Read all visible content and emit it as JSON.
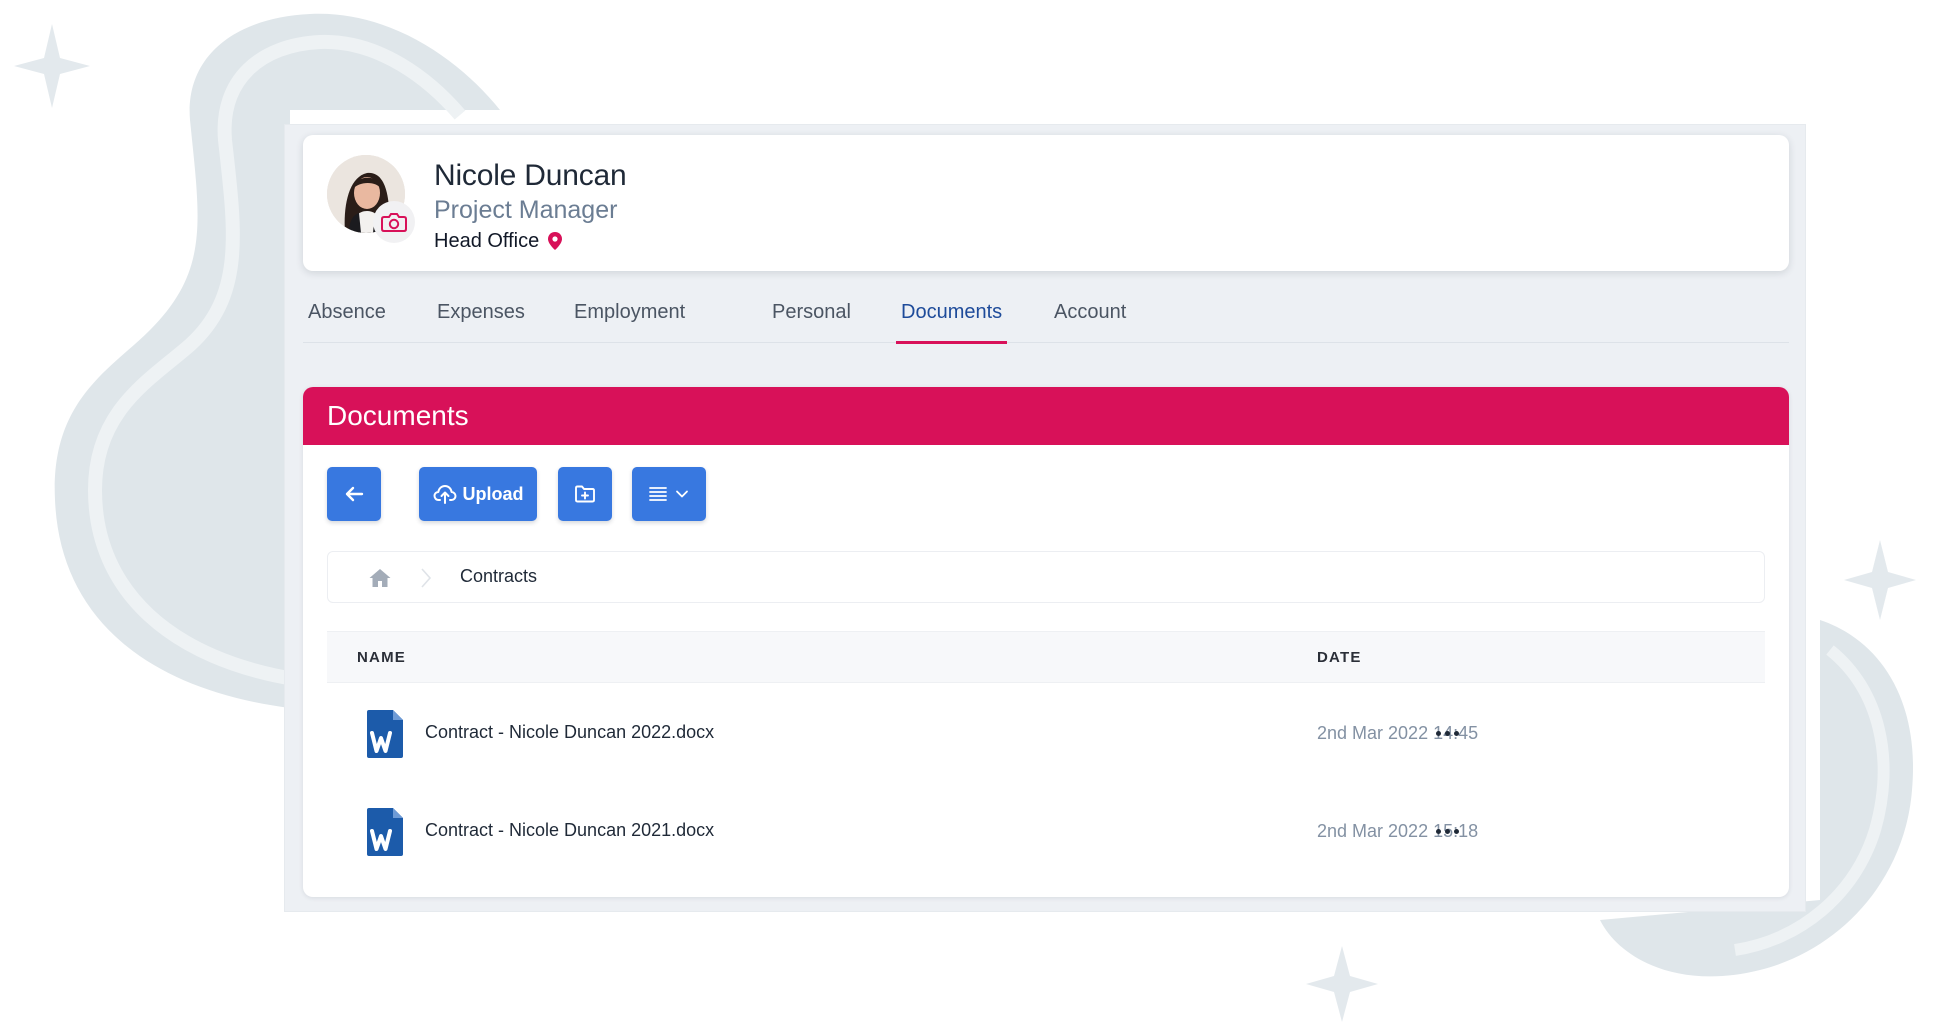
{
  "profile": {
    "name": "Nicole Duncan",
    "role": "Project Manager",
    "location": "Head Office"
  },
  "tabs": [
    {
      "label": "Absence",
      "active": false
    },
    {
      "label": "Expenses",
      "active": false
    },
    {
      "label": "Employment",
      "active": false
    },
    {
      "label": "Personal",
      "active": false
    },
    {
      "label": "Documents",
      "active": true
    },
    {
      "label": "Account",
      "active": false
    }
  ],
  "documents": {
    "title": "Documents",
    "toolbar": {
      "back_icon": "arrow-left-icon",
      "upload_label": "Upload",
      "upload_icon": "cloud-upload-icon",
      "new_folder_icon": "folder-plus-icon",
      "view_icon": "list-view-icon"
    },
    "breadcrumb": {
      "home_icon": "home-icon",
      "current": "Contracts"
    },
    "columns": {
      "name": "NAME",
      "date": "DATE"
    },
    "files": [
      {
        "name": "Contract - Nicole Duncan 2022.docx",
        "date": "2nd Mar 2022 14:45",
        "icon": "word-document-icon"
      },
      {
        "name": "Contract - Nicole Duncan 2021.docx",
        "date": "2nd Mar 2022 15:18",
        "icon": "word-document-icon"
      }
    ]
  },
  "colors": {
    "accent": "#d81159",
    "primary_button": "#3878e0",
    "active_tab": "#1e4b9a",
    "word_blue": "#1c5baa",
    "background": "#edf0f4"
  }
}
